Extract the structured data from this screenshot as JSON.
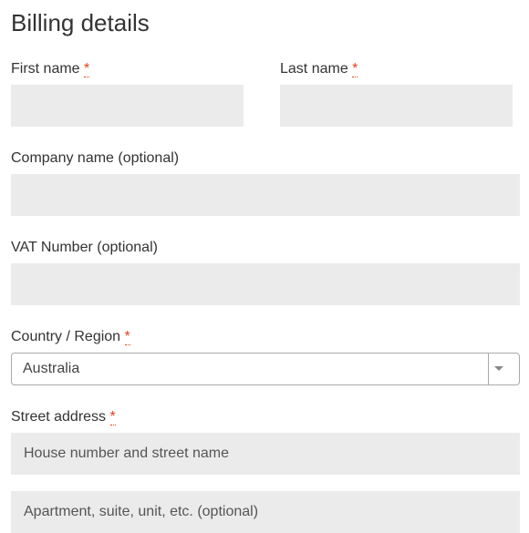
{
  "heading": "Billing details",
  "required_mark": "*",
  "fields": {
    "first_name": {
      "label": "First name ",
      "value": ""
    },
    "last_name": {
      "label": "Last name ",
      "value": ""
    },
    "company": {
      "label": "Company name (optional)",
      "value": ""
    },
    "vat": {
      "label": "VAT Number (optional)",
      "value": ""
    },
    "country": {
      "label": "Country / Region ",
      "value": "Australia"
    },
    "street": {
      "label": "Street address ",
      "placeholder": "House number and street name",
      "value": ""
    },
    "street2": {
      "placeholder": "Apartment, suite, unit, etc. (optional)",
      "value": ""
    }
  }
}
